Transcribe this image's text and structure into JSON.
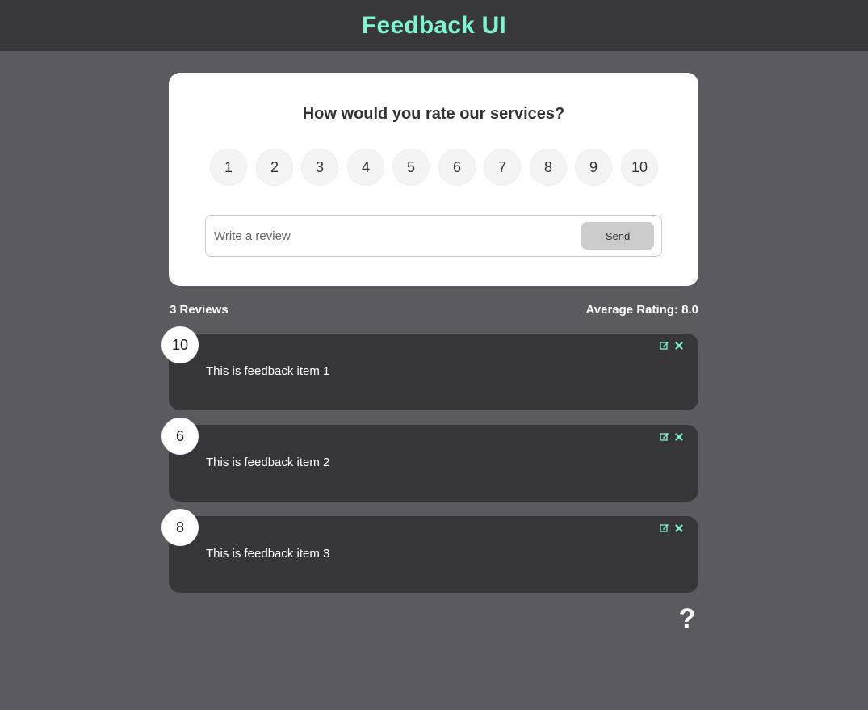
{
  "header": {
    "title": "Feedback UI",
    "accent_color": "#7ff5cf"
  },
  "rating_card": {
    "question": "How would you rate our services?",
    "options": [
      "1",
      "2",
      "3",
      "4",
      "5",
      "6",
      "7",
      "8",
      "9",
      "10"
    ],
    "review_placeholder": "Write a review",
    "review_value": "",
    "send_label": "Send"
  },
  "stats": {
    "count_label": "3 Reviews",
    "average_label": "Average Rating: 8.0"
  },
  "feedback_items": [
    {
      "rating": "10",
      "text": "This is feedback item 1"
    },
    {
      "rating": "6",
      "text": "This is feedback item 2"
    },
    {
      "rating": "8",
      "text": "This is feedback item 3"
    }
  ],
  "icons": {
    "edit": "edit-icon",
    "close": "close-icon",
    "help": "help-icon"
  },
  "help_symbol": "?"
}
